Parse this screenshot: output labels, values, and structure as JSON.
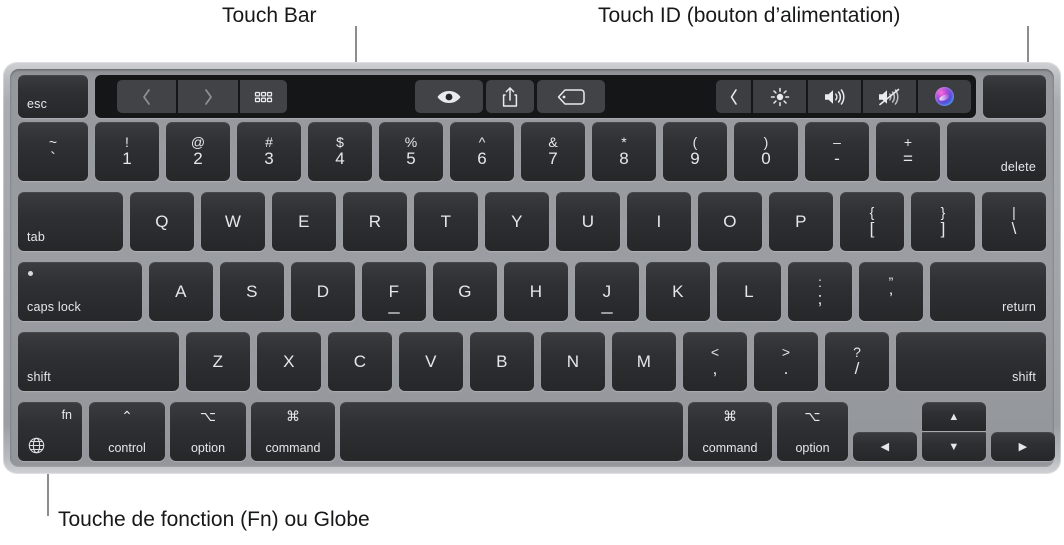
{
  "callouts": {
    "touch_bar": "Touch Bar",
    "touch_id": "Touch ID (bouton d’alimentation)",
    "fn_globe": "Touche de fonction (Fn) ou Globe"
  },
  "colors": {
    "page_background": "#ffffff",
    "keyboard_frame": "#a2a5aa",
    "keyboard_well": "#95989d",
    "key_face": "#2e3033",
    "key_label": "#e6e7e9",
    "touch_bar_background": "#151617",
    "touch_bar_button": "#414347",
    "callout_text": "#17181a",
    "leader_line": "#8d8d8d"
  },
  "touch_bar": {
    "esc_label": "esc",
    "left_group": [
      {
        "name": "back-icon",
        "glyph": "‹"
      },
      {
        "name": "forward-icon",
        "glyph": "›"
      },
      {
        "name": "grid-icon",
        "glyph": "grid"
      }
    ],
    "center_buttons": [
      {
        "name": "eye-icon",
        "glyph": "eye"
      },
      {
        "name": "share-icon",
        "glyph": "share"
      },
      {
        "name": "tag-icon",
        "glyph": "tag"
      }
    ],
    "control_strip": [
      {
        "name": "expand-chevron-icon",
        "glyph": "‹"
      },
      {
        "name": "brightness-icon",
        "glyph": "brightness"
      },
      {
        "name": "volume-up-icon",
        "glyph": "volume"
      },
      {
        "name": "mute-icon",
        "glyph": "mute"
      },
      {
        "name": "siri-icon",
        "glyph": "siri"
      }
    ],
    "touch_id_label": ""
  },
  "rows": {
    "number_row": [
      {
        "name": "key-backtick",
        "type": "dual",
        "upper": "~",
        "lower": "`"
      },
      {
        "name": "key-1",
        "type": "dual",
        "upper": "!",
        "lower": "1"
      },
      {
        "name": "key-2",
        "type": "dual",
        "upper": "@",
        "lower": "2"
      },
      {
        "name": "key-3",
        "type": "dual",
        "upper": "#",
        "lower": "3"
      },
      {
        "name": "key-4",
        "type": "dual",
        "upper": "$",
        "lower": "4"
      },
      {
        "name": "key-5",
        "type": "dual",
        "upper": "%",
        "lower": "5"
      },
      {
        "name": "key-6",
        "type": "dual",
        "upper": "^",
        "lower": "6"
      },
      {
        "name": "key-7",
        "type": "dual",
        "upper": "&",
        "lower": "7"
      },
      {
        "name": "key-8",
        "type": "dual",
        "upper": "*",
        "lower": "8"
      },
      {
        "name": "key-9",
        "type": "dual",
        "upper": "(",
        "lower": "9"
      },
      {
        "name": "key-0",
        "type": "dual",
        "upper": ")",
        "lower": "0"
      },
      {
        "name": "key-minus",
        "type": "dual",
        "upper": "–",
        "lower": "-"
      },
      {
        "name": "key-equal",
        "type": "dual",
        "upper": "+",
        "lower": "="
      },
      {
        "name": "key-delete",
        "type": "br",
        "label": "delete"
      }
    ],
    "top_row": [
      {
        "name": "key-tab",
        "type": "bl",
        "label": "tab"
      },
      {
        "name": "key-q",
        "type": "ctr",
        "label": "Q"
      },
      {
        "name": "key-w",
        "type": "ctr",
        "label": "W"
      },
      {
        "name": "key-e",
        "type": "ctr",
        "label": "E"
      },
      {
        "name": "key-r",
        "type": "ctr",
        "label": "R"
      },
      {
        "name": "key-t",
        "type": "ctr",
        "label": "T"
      },
      {
        "name": "key-y",
        "type": "ctr",
        "label": "Y"
      },
      {
        "name": "key-u",
        "type": "ctr",
        "label": "U"
      },
      {
        "name": "key-i",
        "type": "ctr",
        "label": "I"
      },
      {
        "name": "key-o",
        "type": "ctr",
        "label": "O"
      },
      {
        "name": "key-p",
        "type": "ctr",
        "label": "P"
      },
      {
        "name": "key-bracket-left",
        "type": "dual",
        "upper": "{",
        "lower": "["
      },
      {
        "name": "key-bracket-right",
        "type": "dual",
        "upper": "}",
        "lower": "]"
      },
      {
        "name": "key-backslash",
        "type": "dual",
        "upper": "|",
        "lower": "\\"
      }
    ],
    "home_row": [
      {
        "name": "key-caps-lock",
        "type": "caps",
        "label": "caps lock"
      },
      {
        "name": "key-a",
        "type": "ctr",
        "label": "A"
      },
      {
        "name": "key-s",
        "type": "ctr",
        "label": "S"
      },
      {
        "name": "key-d",
        "type": "ctr",
        "label": "D"
      },
      {
        "name": "key-f",
        "type": "ctr",
        "label": "F",
        "homing": true
      },
      {
        "name": "key-g",
        "type": "ctr",
        "label": "G"
      },
      {
        "name": "key-h",
        "type": "ctr",
        "label": "H"
      },
      {
        "name": "key-j",
        "type": "ctr",
        "label": "J",
        "homing": true
      },
      {
        "name": "key-k",
        "type": "ctr",
        "label": "K"
      },
      {
        "name": "key-l",
        "type": "ctr",
        "label": "L"
      },
      {
        "name": "key-semicolon",
        "type": "dual",
        "upper": ":",
        "lower": ";"
      },
      {
        "name": "key-quote",
        "type": "dual",
        "upper": "”",
        "lower": "’"
      },
      {
        "name": "key-return",
        "type": "br",
        "label": "return"
      }
    ],
    "shift_row": [
      {
        "name": "key-shift-left",
        "type": "bl",
        "label": "shift"
      },
      {
        "name": "key-z",
        "type": "ctr",
        "label": "Z"
      },
      {
        "name": "key-x",
        "type": "ctr",
        "label": "X"
      },
      {
        "name": "key-c",
        "type": "ctr",
        "label": "C"
      },
      {
        "name": "key-v",
        "type": "ctr",
        "label": "V"
      },
      {
        "name": "key-b",
        "type": "ctr",
        "label": "B"
      },
      {
        "name": "key-n",
        "type": "ctr",
        "label": "N"
      },
      {
        "name": "key-m",
        "type": "ctr",
        "label": "M"
      },
      {
        "name": "key-comma",
        "type": "dual",
        "upper": "<",
        "lower": ","
      },
      {
        "name": "key-period",
        "type": "dual",
        "upper": ">",
        "lower": "."
      },
      {
        "name": "key-slash",
        "type": "dual",
        "upper": "?",
        "lower": "/"
      },
      {
        "name": "key-shift-right",
        "type": "br",
        "label": "shift"
      }
    ],
    "bottom_row": [
      {
        "name": "key-fn-globe",
        "type": "fn",
        "label": "fn",
        "icon": "globe-icon"
      },
      {
        "name": "key-control",
        "type": "mod",
        "symbol": "⌃",
        "label": "control"
      },
      {
        "name": "key-option-left",
        "type": "mod",
        "symbol": "⌥",
        "label": "option"
      },
      {
        "name": "key-command-left",
        "type": "mod",
        "symbol": "⌘",
        "label": "command"
      },
      {
        "name": "key-space",
        "type": "blank",
        "label": ""
      },
      {
        "name": "key-command-right",
        "type": "mod",
        "symbol": "⌘",
        "label": "command"
      },
      {
        "name": "key-option-right",
        "type": "mod",
        "symbol": "⌥",
        "label": "option"
      }
    ],
    "arrows": [
      {
        "name": "key-arrow-left",
        "glyph": "◀"
      },
      {
        "name": "key-arrow-up",
        "glyph": "▲"
      },
      {
        "name": "key-arrow-down",
        "glyph": "▼"
      },
      {
        "name": "key-arrow-right",
        "glyph": "▶"
      }
    ]
  }
}
